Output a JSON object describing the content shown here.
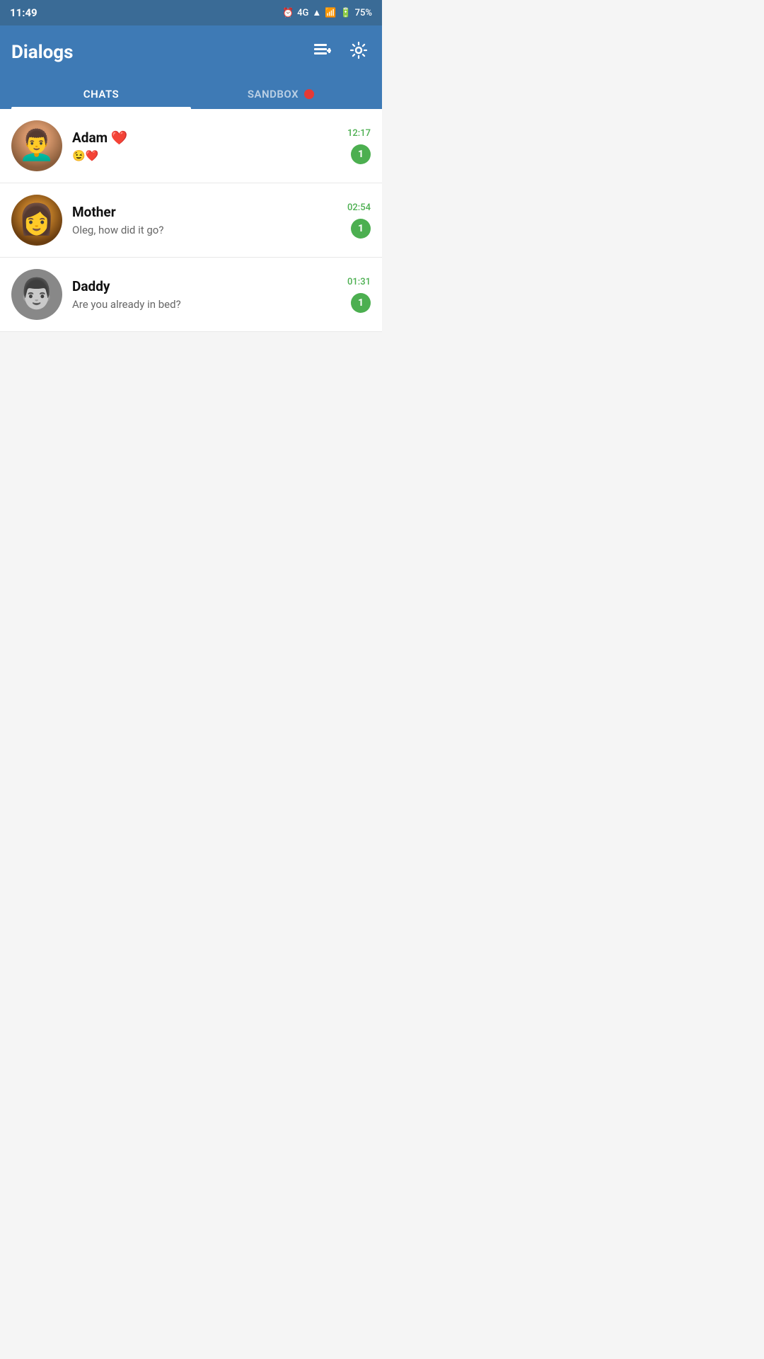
{
  "statusBar": {
    "time": "11:49",
    "battery": "75%",
    "signal": "4G"
  },
  "header": {
    "title": "Dialogs",
    "composeLabel": "compose",
    "settingsLabel": "settings"
  },
  "tabs": [
    {
      "id": "chats",
      "label": "CHATS",
      "active": true
    },
    {
      "id": "sandbox",
      "label": "SANDBOX",
      "active": false
    }
  ],
  "chats": [
    {
      "id": "adam",
      "name": "Adam ❤️",
      "nameText": "Adam",
      "nameEmoji": "❤️",
      "preview": "😉❤️",
      "time": "12:17",
      "unread": "1",
      "avatarType": "adam"
    },
    {
      "id": "mother",
      "name": "Mother",
      "preview": "Oleg, how did it go?",
      "time": "02:54",
      "unread": "1",
      "avatarType": "mother"
    },
    {
      "id": "daddy",
      "name": "Daddy",
      "preview": "Are you already in bed?",
      "time": "01:31",
      "unread": "1",
      "avatarType": "daddy"
    }
  ]
}
